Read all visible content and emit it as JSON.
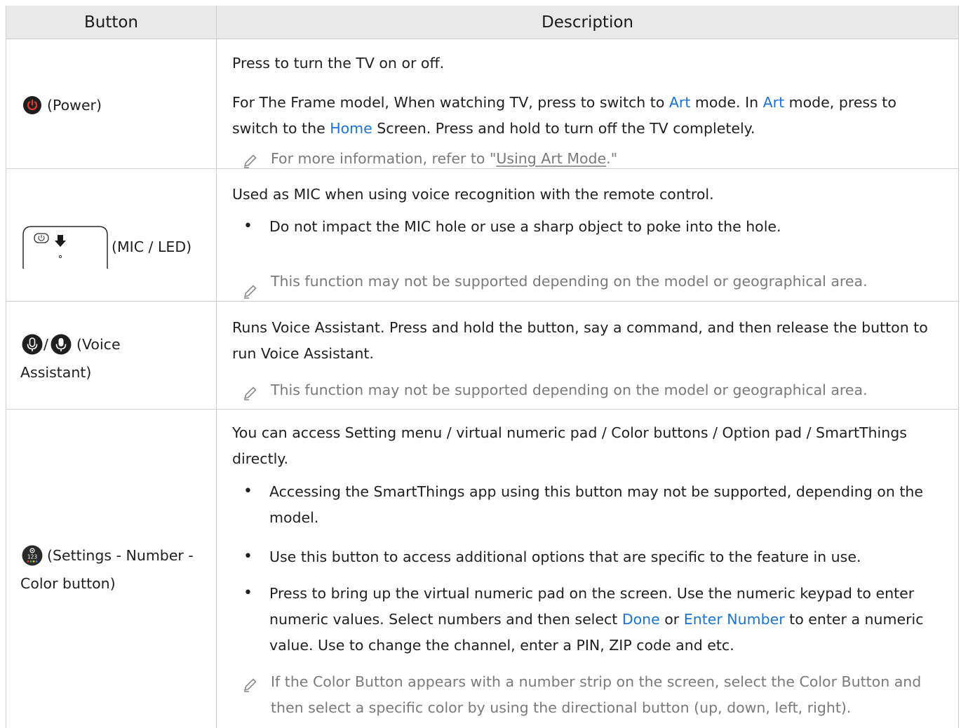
{
  "table": {
    "headers": [
      "Button",
      "Description"
    ],
    "rows": [
      {
        "button": {
          "icon": "power-icon",
          "label": "(Power)"
        },
        "description": {
          "p1": "Press to turn the TV on or off.",
          "p2_a": "For The Frame model, When watching TV, press to switch to ",
          "p2_b": "Art",
          "p2_c": " mode. In ",
          "p2_d": "Art",
          "p2_e": " mode, press to",
          "p3_a": "switch to the ",
          "p3_b": "Home",
          "p3_c": " Screen. Press and hold to turn off the TV completely.",
          "note_a": "For more information, refer to \"",
          "note_link": "Using Art Mode",
          "note_b": ".\""
        }
      },
      {
        "button": {
          "icon": "mic-led-icon",
          "label": "(MIC / LED)"
        },
        "description": {
          "p1": "Used as MIC when using voice recognition with the remote control.",
          "bullet1": "Do not impact the MIC hole or use a sharp object to poke into the hole.",
          "note": "This function may not be supported depending on the model or geographical area."
        }
      },
      {
        "button": {
          "icon": "voice-assistant-icon",
          "label_line1": "(Voice",
          "label_line2": "Assistant)",
          "sep": "/"
        },
        "description": {
          "p1": "Runs Voice Assistant. Press and hold the button, say a command, and then release the button to",
          "p2": "run Voice Assistant.",
          "note": "This function may not be supported depending on the model or geographical area."
        }
      },
      {
        "button": {
          "icon": "settings-number-color-icon",
          "label_line1": "(Settings - Number -",
          "label_line2": "Color button)"
        },
        "description": {
          "p1": "You can access Setting menu / virtual numeric pad / Color buttons / Option pad / SmartThings",
          "p2": "directly.",
          "b1_l1": "Accessing the SmartThings app using this button may not be supported, depending on the",
          "b1_l2": "model.",
          "b2": "Use this button to access additional options that are specific to the feature in use.",
          "b3_l1": "Press to bring up the virtual numeric pad on the screen. Use the numeric keypad to enter",
          "b3_l2_a": "numeric values. Select numbers and then select ",
          "b3_l2_b": "Done",
          "b3_l2_c": " or ",
          "b3_l2_d": "Enter Number",
          "b3_l2_e": " to enter a numeric",
          "b3_l3": "value. Use to change the channel, enter a PIN, ZIP code and etc.",
          "note_l1": "If the Color Button appears with a number strip on the screen, select the Color Button and",
          "note_l2": "then select a specific color by using the directional button (up, down, left, right)."
        }
      }
    ]
  },
  "colors": {
    "header_bg": "#e9e9e9",
    "border": "#cfcfcf",
    "link": "#1a73d9",
    "note_text": "#7a7a7a",
    "power_red": "#d12b22"
  }
}
